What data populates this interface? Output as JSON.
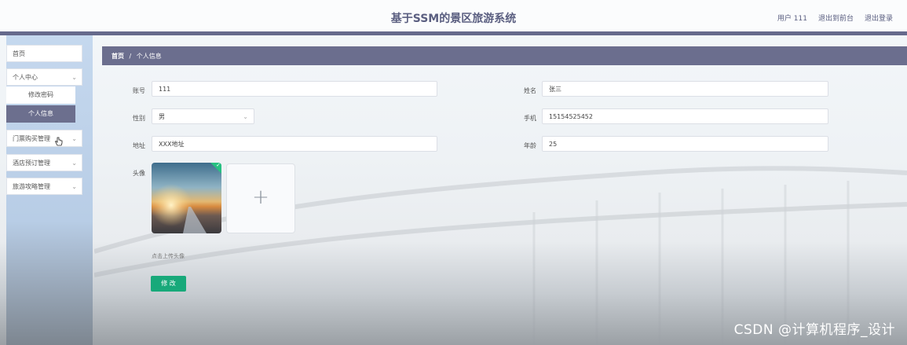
{
  "header": {
    "title": "基于SSM的景区旅游系统",
    "user": "用户 111",
    "back_front": "退出到前台",
    "logout": "退出登录"
  },
  "sidebar": {
    "items": [
      {
        "label": "首页"
      },
      {
        "label": "个人中心"
      },
      {
        "label": "门票购买管理"
      },
      {
        "label": "酒店预订管理"
      },
      {
        "label": "旅游攻略管理"
      }
    ],
    "submenu": [
      {
        "label": "修改密码"
      },
      {
        "label": "个人信息",
        "active": true
      }
    ]
  },
  "breadcrumb": {
    "home": "首页",
    "sep": "/",
    "current": "个人信息"
  },
  "form": {
    "account_label": "账号",
    "account_value": "111",
    "name_label": "姓名",
    "name_value": "张三",
    "gender_label": "性别",
    "gender_value": "男",
    "phone_label": "手机",
    "phone_value": "15154525452",
    "address_label": "地址",
    "address_value": "XXX地址",
    "age_label": "年龄",
    "age_value": "25",
    "avatar_label": "头像",
    "upload_hint": "点击上传头像",
    "submit_label": "修 改"
  },
  "watermark": "CSDN @计算机程序_设计",
  "colors": {
    "nav_dark": "#666a8c",
    "primary_button": "#18a97a",
    "sidebar_bg": "#c5d8ee"
  }
}
